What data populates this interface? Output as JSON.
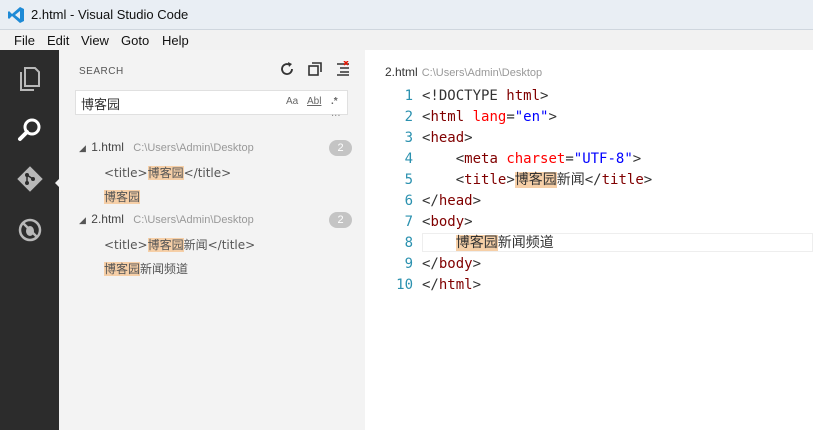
{
  "window": {
    "title": "2.html - Visual Studio Code"
  },
  "menu": [
    "File",
    "Edit",
    "View",
    "Goto",
    "Help"
  ],
  "activity_bar": [
    "explorer-icon",
    "search-icon",
    "git-icon",
    "debug-icon"
  ],
  "search": {
    "title": "SEARCH",
    "query": "博客园",
    "options": {
      "match_case": "Aa",
      "whole_word": "Abl",
      "regex": ".*"
    },
    "more": "···",
    "results": [
      {
        "file": "1.html",
        "path": "C:\\Users\\Admin\\Desktop",
        "count": "2",
        "matches": [
          {
            "before": "<title>",
            "hit": "博客园",
            "after": "</title>"
          },
          {
            "before": "",
            "hit": "博客园",
            "after": ""
          }
        ]
      },
      {
        "file": "2.html",
        "path": "C:\\Users\\Admin\\Desktop",
        "count": "2",
        "matches": [
          {
            "before": "<title>",
            "hit": "博客园",
            "after": "新闻</title>"
          },
          {
            "before": "",
            "hit": "博客园",
            "after": "新闻频道"
          }
        ]
      }
    ]
  },
  "editor": {
    "file": "2.html",
    "path": "C:\\Users\\Admin\\Desktop",
    "lines": [
      {
        "n": "1",
        "parts": [
          [
            "pun",
            "<!DOCTYPE "
          ],
          [
            "tag",
            "html"
          ],
          [
            "pun",
            ">"
          ]
        ]
      },
      {
        "n": "2",
        "parts": [
          [
            "pun",
            "<"
          ],
          [
            "tag",
            "html"
          ],
          [
            "pun",
            " "
          ],
          [
            "attr",
            "lang"
          ],
          [
            "pun",
            "="
          ],
          [
            "str",
            "\"en\""
          ],
          [
            "pun",
            ">"
          ]
        ]
      },
      {
        "n": "3",
        "parts": [
          [
            "pun",
            "<"
          ],
          [
            "tag",
            "head"
          ],
          [
            "pun",
            ">"
          ]
        ]
      },
      {
        "n": "4",
        "parts": [
          [
            "pun",
            "    <"
          ],
          [
            "tag",
            "meta"
          ],
          [
            "pun",
            " "
          ],
          [
            "attr",
            "charset"
          ],
          [
            "pun",
            "="
          ],
          [
            "str",
            "\"UTF-8\""
          ],
          [
            "pun",
            ">"
          ]
        ]
      },
      {
        "n": "5",
        "parts": [
          [
            "pun",
            "    <"
          ],
          [
            "tag",
            "title"
          ],
          [
            "pun",
            ">"
          ],
          [
            "hl",
            "博客园"
          ],
          [
            "pun",
            "新闻</"
          ],
          [
            "tag",
            "title"
          ],
          [
            "pun",
            ">"
          ]
        ]
      },
      {
        "n": "6",
        "parts": [
          [
            "pun",
            "</"
          ],
          [
            "tag",
            "head"
          ],
          [
            "pun",
            ">"
          ]
        ]
      },
      {
        "n": "7",
        "parts": [
          [
            "pun",
            "<"
          ],
          [
            "tag",
            "body"
          ],
          [
            "pun",
            ">"
          ]
        ]
      },
      {
        "n": "8",
        "parts": [
          [
            "pun",
            "    "
          ],
          [
            "hl",
            "博客园"
          ],
          [
            "pun",
            "新闻频道"
          ]
        ],
        "current": true
      },
      {
        "n": "9",
        "parts": [
          [
            "pun",
            "</"
          ],
          [
            "tag",
            "body"
          ],
          [
            "pun",
            ">"
          ]
        ]
      },
      {
        "n": "10",
        "parts": [
          [
            "pun",
            "</"
          ],
          [
            "tag",
            "html"
          ],
          [
            "pun",
            ">"
          ]
        ]
      }
    ]
  }
}
